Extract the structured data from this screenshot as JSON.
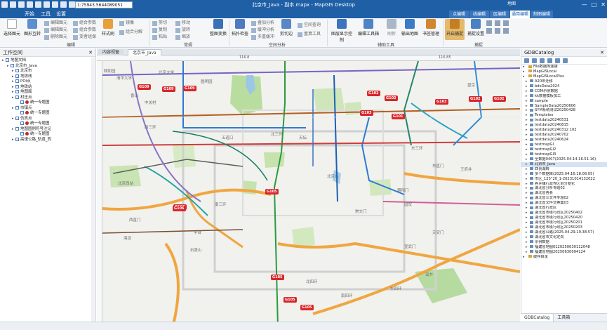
{
  "titlebar": {
    "scale_value": "1:75943.5644089051",
    "title": "北京市_Java - 副本.mapx - MapGIS Desktop",
    "context_title": "地图",
    "win_buttons": [
      "—",
      "□",
      "✕"
    ]
  },
  "menubar": {
    "items": [
      "开始",
      "工具",
      "设置"
    ],
    "context_tabs": [
      "点编辑",
      "线编辑",
      "区编辑",
      "通用编辑",
      "制图编辑"
    ],
    "active_context_tab": "通用编辑"
  },
  "ribbon": {
    "groups": [
      {
        "label": "编辑"
      },
      {
        "label": "常规"
      },
      {
        "label": "空间分析"
      },
      {
        "label": "辅助工具"
      },
      {
        "label": "捕捉"
      }
    ],
    "big_buttons": [
      {
        "label": "选择图元",
        "icon": "cursor-icon"
      },
      {
        "label": "图形互转",
        "icon": "convert-icon"
      },
      {
        "label": "样式刷",
        "icon": "brush-icon"
      },
      {
        "label": "整图变换",
        "icon": "transform-icon"
      },
      {
        "label": "拓扑检查",
        "icon": "topology-icon"
      },
      {
        "label": "剪切边",
        "icon": "clip-edge-icon"
      },
      {
        "label": "图层显示控制",
        "icon": "layer-display-icon"
      },
      {
        "label": "编辑工具箱",
        "icon": "toolbox-icon"
      },
      {
        "label": "刷新",
        "icon": "refresh-icon"
      },
      {
        "label": "输出地图",
        "icon": "export-map-icon"
      },
      {
        "label": "书签管理",
        "icon": "bookmark-icon"
      },
      {
        "label": "开启捕捉",
        "icon": "snap-icon"
      },
      {
        "label": "捕捉设置",
        "icon": "snap-settings-icon"
      }
    ],
    "small_buttons": [
      {
        "label": "编辑图元"
      },
      {
        "label": "编辑图元"
      },
      {
        "label": "删除图元"
      },
      {
        "label": "组合参数"
      },
      {
        "label": "组合参数"
      },
      {
        "label": "变者组保"
      },
      {
        "label": "镜像"
      },
      {
        "label": "组合分解"
      },
      {
        "label": "剪切"
      },
      {
        "label": "复制"
      },
      {
        "label": "粘贴"
      },
      {
        "label": "移动"
      },
      {
        "label": "旋转"
      },
      {
        "label": "缩放"
      },
      {
        "label": "叠加分析"
      },
      {
        "label": "缓冲分析"
      },
      {
        "label": "多重缓冲"
      },
      {
        "label": "空间查询"
      },
      {
        "label": "量算工具"
      }
    ]
  },
  "workspace": {
    "title": "工作空间",
    "tree": [
      {
        "label": "地图文档",
        "level": 0
      },
      {
        "label": "北京市_Java",
        "level": 1
      },
      {
        "label": "北京市",
        "level": 2
      },
      {
        "label": "地铁线",
        "level": 2
      },
      {
        "label": "POI点",
        "level": 2
      },
      {
        "label": "地铁站",
        "level": 2
      },
      {
        "label": "地图面",
        "level": 2
      },
      {
        "label": "村庄点",
        "level": 2
      },
      {
        "label": "统一专题图",
        "level": 3
      },
      {
        "label": "市镇点",
        "level": 2
      },
      {
        "label": "统一专题图",
        "level": 3
      },
      {
        "label": "仿真点",
        "level": 2
      },
      {
        "label": "统一专题图",
        "level": 3
      },
      {
        "label": "地图图例符号注记",
        "level": 2
      },
      {
        "label": "统一专题图",
        "level": 3
      },
      {
        "label": "高速公路_轨道_西",
        "level": 2
      }
    ]
  },
  "doc_tabs": [
    {
      "label": "内容视窗",
      "active": false
    },
    {
      "label": "北京市_Java",
      "active": true
    }
  ],
  "ruler": {
    "top_labels": [
      "116.8",
      "116.85"
    ],
    "left_labels": [
      "39.95",
      "39.9"
    ]
  },
  "map": {
    "district_labels": [
      "颐和园",
      "北京大学",
      "清华大学",
      "圆明园",
      "香山",
      "中关村",
      "五道口",
      "北京西站",
      "天坛",
      "王府井",
      "朝阳门",
      "望京",
      "国贸",
      "东直门",
      "西直门",
      "海淀",
      "丰台",
      "石景山",
      "崇文门",
      "宣武门",
      "天安门",
      "北京站",
      "双井",
      "南三环",
      "北三环",
      "东三环",
      "西三环",
      "北四环",
      "南四环",
      "东四环"
    ],
    "road_shields": [
      "G109",
      "G109",
      "G109",
      "G102",
      "G102",
      "G103",
      "G101",
      "G103",
      "G102",
      "G102",
      "G106",
      "G106",
      "G105",
      "G105",
      "G105",
      "G105"
    ]
  },
  "catalog": {
    "title": "GDBCatalog",
    "items": [
      {
        "label": "File数据库连接",
        "level": 0
      },
      {
        "label": "MapGISLocal",
        "level": 0
      },
      {
        "label": "MapGISLocalPlus",
        "level": 0
      },
      {
        "label": "A20年迁移",
        "level": 1
      },
      {
        "label": "bdxData2024",
        "level": 1
      },
      {
        "label": "CDM示例数据",
        "level": 1
      },
      {
        "label": "kk数据模板加工",
        "level": 1
      },
      {
        "label": "sample",
        "level": 1
      },
      {
        "label": "SampleData20250606",
        "level": 1
      },
      {
        "label": "SYM系统测试20250428",
        "level": 1
      },
      {
        "label": "Templates",
        "level": 1
      },
      {
        "label": "testdata20240531",
        "level": 1
      },
      {
        "label": "testdata20240815",
        "level": 1
      },
      {
        "label": "testdata20240312 102",
        "level": 1
      },
      {
        "label": "testdata20240702",
        "level": 1
      },
      {
        "label": "testdata20240624",
        "level": 1
      },
      {
        "label": "testmapGI",
        "level": 1
      },
      {
        "label": "testmapGI2",
        "level": 1
      },
      {
        "label": "testmapGI3",
        "level": 1
      },
      {
        "label": "全数据0407(2025.04.14.16.51.16)",
        "level": 1
      },
      {
        "label": "北京市_Java",
        "level": 1,
        "selected": true
      },
      {
        "label": "四贵湖转",
        "level": 1
      },
      {
        "label": "多个数据库(2025.04.16.18.08.05)",
        "level": 1
      },
      {
        "label": "市区_125°20_1-20231014132022",
        "level": 1
      },
      {
        "label": "各乡镇行政界区划分变化",
        "level": 1
      },
      {
        "label": "湖北省分析专题02",
        "level": 1
      },
      {
        "label": "湖北省各县",
        "level": 1
      },
      {
        "label": "湖北省三文件专题02",
        "level": 1
      },
      {
        "label": "湖北省文件交换集03",
        "level": 1
      },
      {
        "label": "湖北省行政区",
        "level": 1
      },
      {
        "label": "湖北省市级行政区20250402",
        "level": 1
      },
      {
        "label": "湖北省市级行政区20250420",
        "level": 1
      },
      {
        "label": "湖北省市级行政区20250201",
        "level": 1
      },
      {
        "label": "湖北省市级行政区20250203",
        "level": 1
      },
      {
        "label": "湖北省公路(2025.04.29.19.38.57)",
        "level": 1
      },
      {
        "label": "湖北省市文化定向",
        "level": 1
      },
      {
        "label": "示例数据",
        "level": 1
      },
      {
        "label": "福建省地图0120250630112048",
        "level": 1
      },
      {
        "label": "福建省地图20250630094124",
        "level": 1
      },
      {
        "label": "缓存目录",
        "level": 0
      }
    ],
    "bottom_tabs": [
      "GDBCatalog",
      "工具箱"
    ]
  }
}
